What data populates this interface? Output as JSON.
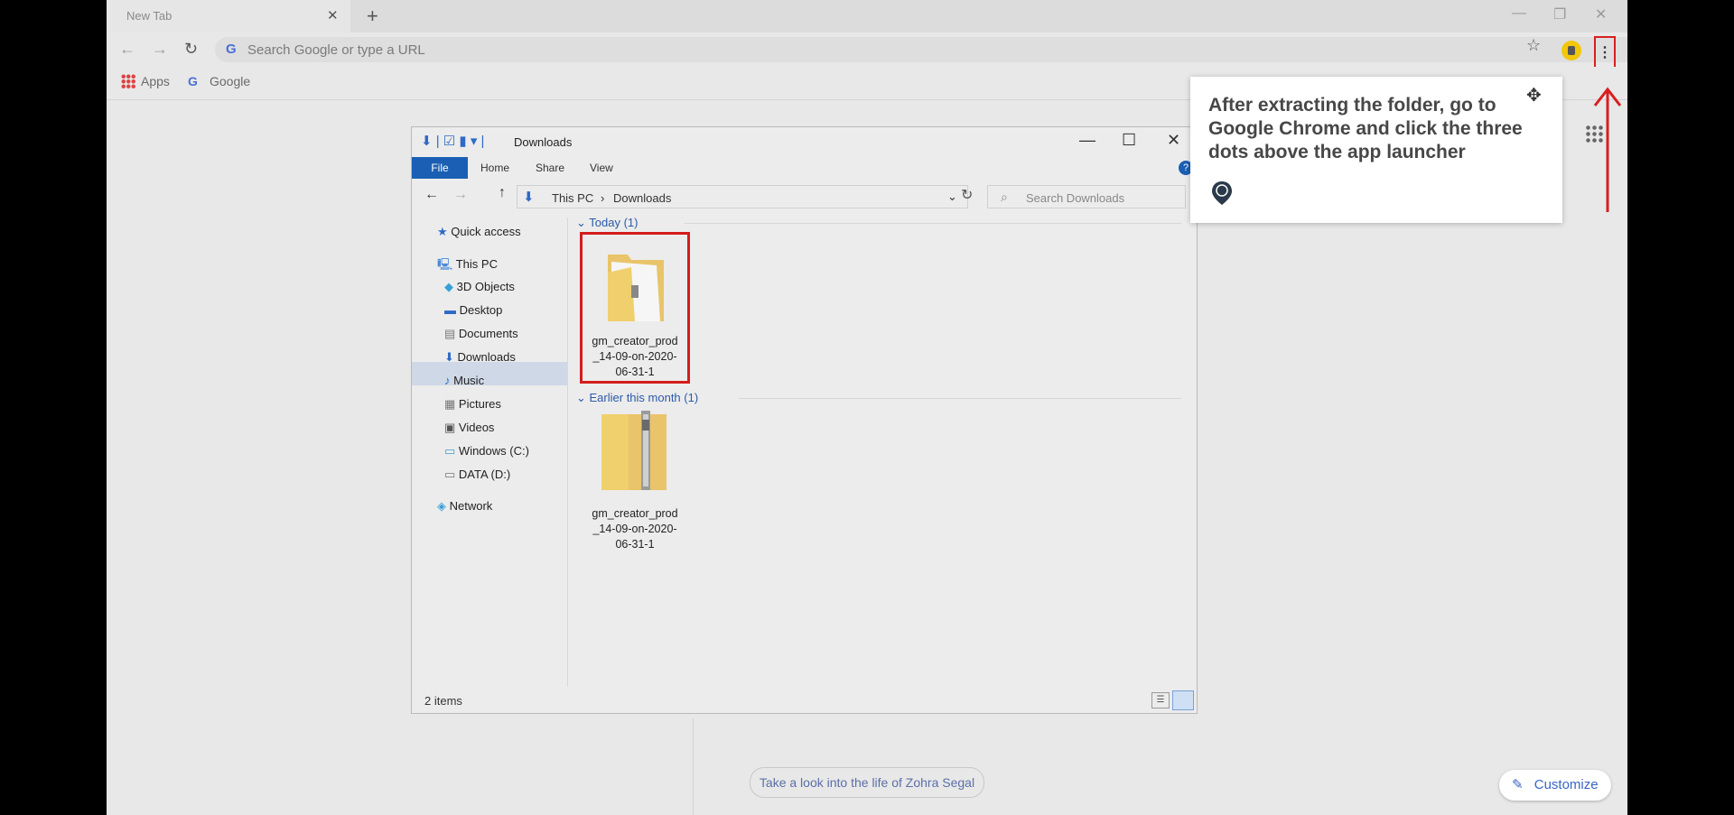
{
  "browser": {
    "tab_title": "New Tab",
    "tab_close": "✕",
    "new_tab": "+",
    "window_controls": {
      "minimize": "—",
      "restore": "❐",
      "close": "✕"
    },
    "nav": {
      "back": "←",
      "forward": "→",
      "reload": "↻"
    },
    "omnibox_placeholder": "Search Google or type a URL",
    "google_g": "G",
    "bookmark_star": "☆",
    "menu_dots": "⋮",
    "bookmarks": {
      "apps": "Apps",
      "google": "Google"
    }
  },
  "ntp": {
    "promo": "Take a look into the life of Zohra Segal",
    "customize": "Customize",
    "customize_icon": "✎"
  },
  "explorer": {
    "title": "Downloads",
    "title_icons": "⬇ | ☑ ▮ ▾ |",
    "window_controls": {
      "minimize": "—",
      "maximize": "☐",
      "close": "✕"
    },
    "ribbon": {
      "file": "File",
      "tabs": [
        "Home",
        "Share",
        "View"
      ],
      "help": "?"
    },
    "address": {
      "pc": "This PC",
      "sep": "›",
      "folder": "Downloads"
    },
    "search_placeholder": "Search Downloads",
    "nav_items": [
      {
        "label": "Quick access",
        "icon": "★"
      },
      {
        "label": "This PC",
        "icon": "🖳"
      },
      {
        "label": "3D Objects",
        "icon": "◆"
      },
      {
        "label": "Desktop",
        "icon": "▬"
      },
      {
        "label": "Documents",
        "icon": "▤"
      },
      {
        "label": "Downloads",
        "icon": "⬇"
      },
      {
        "label": "Music",
        "icon": "♪"
      },
      {
        "label": "Pictures",
        "icon": "▦"
      },
      {
        "label": "Videos",
        "icon": "▣"
      },
      {
        "label": "Windows (C:)",
        "icon": "▭"
      },
      {
        "label": "DATA (D:)",
        "icon": "▭"
      },
      {
        "label": "Network",
        "icon": "◈"
      }
    ],
    "groups": [
      {
        "label": "Today (1)",
        "file": {
          "name_line1": "gm_creator_prod",
          "name_line2": "_14-09-on-2020-",
          "name_line3": "06-31-1"
        }
      },
      {
        "label": "Earlier this month (1)",
        "file": {
          "name_line1": "gm_creator_prod",
          "name_line2": "_14-09-on-2020-",
          "name_line3": "06-31-1"
        }
      }
    ],
    "status": "2 items"
  },
  "tooltip": {
    "text": "After extracting the folder, go to Google Chrome and click the three dots above the app launcher",
    "move_icon": "✥",
    "brand_letter": "G"
  },
  "colors": {
    "highlight": "#d91e1e",
    "file_tab": "#1a5fb4",
    "link": "#3a66c4"
  }
}
